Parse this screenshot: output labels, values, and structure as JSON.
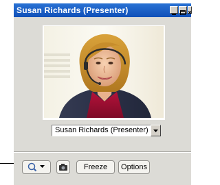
{
  "window": {
    "title": "Susan Richards (Presenter)"
  },
  "presenter_select": {
    "selected": "Susan Richards (Presenter)"
  },
  "toolbar": {
    "freeze_label": "Freeze",
    "options_label": "Options"
  },
  "icons": {
    "zoom": "magnifier-icon",
    "dropdown": "chevron-down-icon",
    "snapshot": "camera-icon",
    "minimize": "minimize-icon",
    "maximize": "maximize-icon",
    "close": "close-icon"
  },
  "colors": {
    "titlebar": "#1a5fc8",
    "window_bg": "#dcdbd6",
    "button_bg": "#f4f3ef"
  }
}
